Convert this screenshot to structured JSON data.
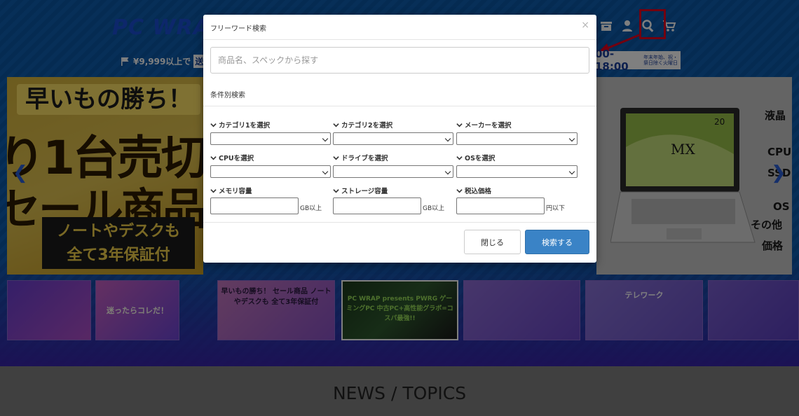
{
  "header": {
    "logo": "PC WRAP",
    "shipping_amount": "¥9,999以上で",
    "shipping_highlight": "送料",
    "hours": "00-18:00",
    "hours_note": "年末年始、祝・祭日除く火曜日"
  },
  "banner_left": {
    "headline": "早いもの勝ち！",
    "big_line1": "り1台売切",
    "big_line2": "セール商品",
    "footer_line1": "ノートやデスクも",
    "footer_line2": "全て3年保証付"
  },
  "banner_right": {
    "model": "MX",
    "badge": "20",
    "spec_labels": [
      "液晶",
      "CPU",
      "SSD",
      "OS",
      "その他",
      "価格"
    ]
  },
  "thumbnails": [
    {
      "text": ""
    },
    {
      "text": "迷ったらコレだ！"
    },
    {
      "text": "早いもの勝ち！ セール商品 ノートやデスクも 全て3年保証付"
    },
    {
      "text": "PC WRAP presents PWRG ゲーミングPC 中古PC+高性能グラボ=コスパ最強!!"
    },
    {
      "text": ""
    },
    {
      "text": "テレワーク"
    },
    {
      "text": ""
    }
  ],
  "news": {
    "title": "NEWS / TOPICS"
  },
  "modal": {
    "title": "フリーワード検索",
    "close_icon": "×",
    "search_placeholder": "商品名、スペックから探す",
    "condition_title": "条件別検索",
    "fields": {
      "category1": "カテゴリ1を選択",
      "category2": "カテゴリ2を選択",
      "maker": "メーカーを選択",
      "cpu": "CPUを選択",
      "drive": "ドライブを選択",
      "os": "OSを選択",
      "memory": "メモリ容量",
      "storage": "ストレージ容量",
      "price": "税込価格"
    },
    "units": {
      "memory": "GB以上",
      "storage": "GB以上",
      "price": "円以下"
    },
    "buttons": {
      "close": "閉じる",
      "search": "検索する"
    }
  },
  "colors": {
    "header_blue": "#0e5fb0",
    "search_button": "#3a83c6",
    "highlight_red": "#e6001e"
  }
}
